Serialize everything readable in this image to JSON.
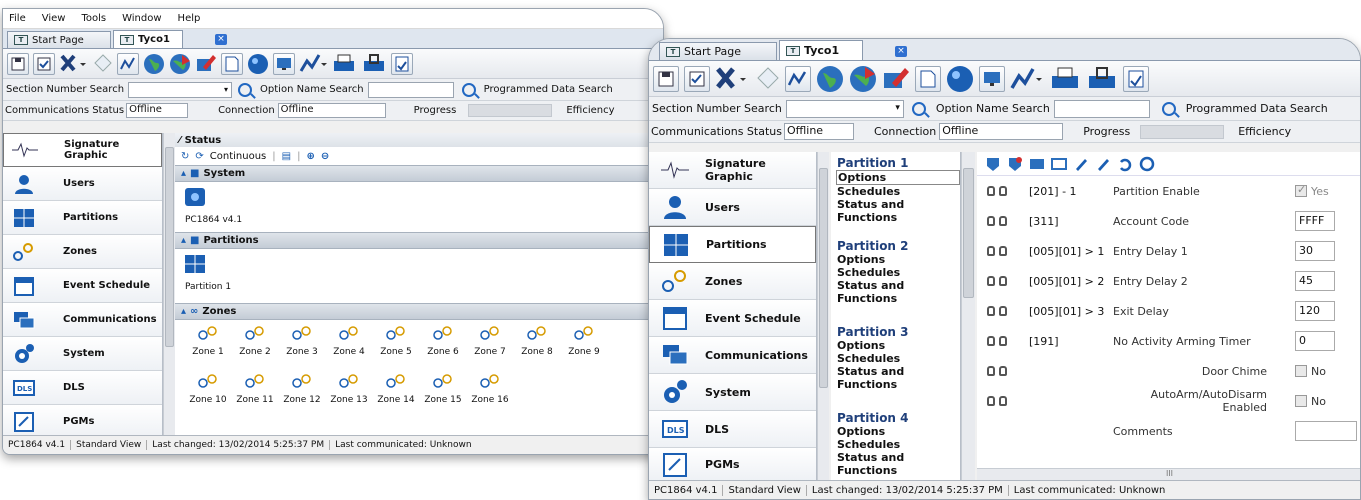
{
  "colors": {
    "accent": "#2268c2",
    "dark_blue": "#1f3f7a",
    "border": "#9aa4b0"
  },
  "back_window": {
    "menu": [
      "File",
      "View",
      "Tools",
      "Window",
      "Help"
    ],
    "tabs": [
      {
        "label": "Start Page"
      },
      {
        "label": "Tyco1"
      }
    ],
    "search": {
      "section_label": "Section Number Search",
      "option_label": "Option Name Search",
      "programmed_label": "Programmed Data Search"
    },
    "comm": {
      "status_label": "Communications Status",
      "status_value": "Offline",
      "connection_label": "Connection",
      "connection_value": "Offline",
      "progress_label": "Progress",
      "efficiency_label": "Efficiency"
    },
    "nav": [
      "Signature Graphic",
      "Users",
      "Partitions",
      "Zones",
      "Event Schedule",
      "Communications",
      "System",
      "DLS",
      "PGMs"
    ],
    "status_title": "Status",
    "continuous": "Continuous",
    "system_header": "System",
    "system_item": "PC1864 v4.1",
    "partitions_header": "Partitions",
    "partition_item": "Partition 1",
    "zones_header": "Zones",
    "zones": [
      "Zone 1",
      "Zone 2",
      "Zone 3",
      "Zone 4",
      "Zone 5",
      "Zone 6",
      "Zone 7",
      "Zone 8",
      "Zone 9",
      "Zone 10",
      "Zone 11",
      "Zone 12",
      "Zone 13",
      "Zone 14",
      "Zone 15",
      "Zone 16"
    ],
    "statusbar": [
      "PC1864 v4.1",
      "Standard View",
      "Last changed: 13/02/2014 5:25:37 PM",
      "Last communicated: Unknown"
    ]
  },
  "front_window": {
    "tabs": [
      {
        "label": "Start Page"
      },
      {
        "label": "Tyco1"
      }
    ],
    "search": {
      "section_label": "Section Number Search",
      "option_label": "Option Name Search",
      "programmed_label": "Programmed Data Search"
    },
    "comm": {
      "status_label": "Communications Status",
      "status_value": "Offline",
      "connection_label": "Connection",
      "connection_value": "Offline",
      "progress_label": "Progress",
      "efficiency_label": "Efficiency"
    },
    "nav": [
      "Signature Graphic",
      "Users",
      "Partitions",
      "Zones",
      "Event Schedule",
      "Communications",
      "System",
      "DLS",
      "PGMs"
    ],
    "nav_selected": "Partitions",
    "partitions": [
      {
        "title": "Partition 1",
        "items": [
          "Options",
          "Schedules",
          "Status and Functions"
        ]
      },
      {
        "title": "Partition 2",
        "items": [
          "Options",
          "Schedules",
          "Status and Functions"
        ]
      },
      {
        "title": "Partition 3",
        "items": [
          "Options",
          "Schedules",
          "Status and Functions"
        ]
      },
      {
        "title": "Partition 4",
        "items": [
          "Options",
          "Schedules",
          "Status and Functions"
        ]
      }
    ],
    "options": [
      {
        "code": "[201] - 1",
        "name": "Partition Enable",
        "value": "Yes",
        "type": "check",
        "checked": true
      },
      {
        "code": "[311]",
        "name": "Account Code",
        "value": "FFFF",
        "type": "text"
      },
      {
        "code": "[005][01] > 1",
        "name": "Entry Delay 1",
        "value": "30",
        "type": "text"
      },
      {
        "code": "[005][01] > 2",
        "name": "Entry Delay 2",
        "value": "45",
        "type": "text"
      },
      {
        "code": "[005][01] > 3",
        "name": "Exit Delay",
        "value": "120",
        "type": "text"
      },
      {
        "code": "[191]",
        "name": "No Activity Arming Timer",
        "value": "0",
        "type": "text"
      },
      {
        "code": "",
        "name": "Door Chime",
        "value": "No",
        "type": "check",
        "checked": false
      },
      {
        "code": "",
        "name": "AutoArm/AutoDisarm Enabled",
        "value": "No",
        "type": "check",
        "checked": false
      },
      {
        "code": "",
        "name": "Comments",
        "value": "",
        "type": "text"
      }
    ],
    "hscroll_grip": "III",
    "statusbar": [
      "PC1864 v4.1",
      "Standard View",
      "Last changed: 13/02/2014 5:25:37 PM",
      "Last communicated: Unknown"
    ]
  }
}
